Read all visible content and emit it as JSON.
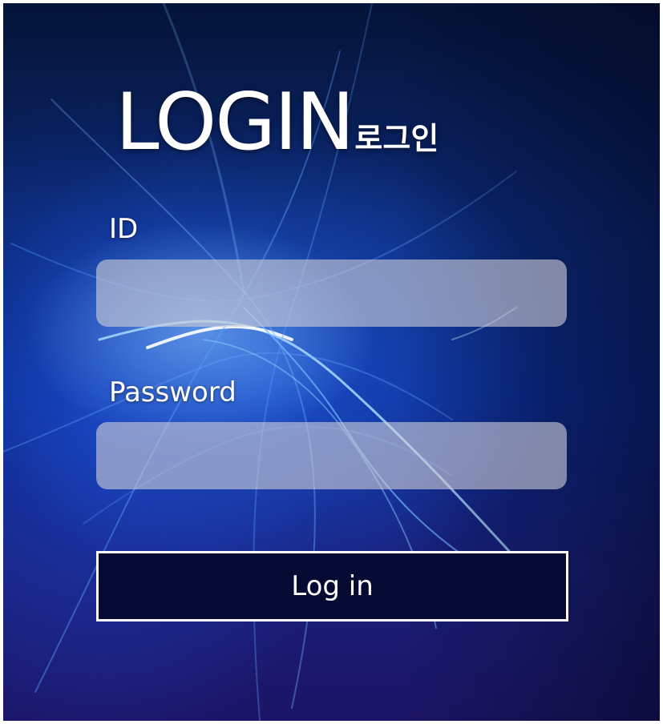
{
  "title": {
    "main": "LOGIN",
    "sub": "로그인"
  },
  "form": {
    "id_label": "ID",
    "id_value": "",
    "password_label": "Password",
    "password_value": "",
    "submit_label": "Log in"
  },
  "colors": {
    "background_dark": "#0b2a7a",
    "input_fill": "#c8c8d2",
    "button_fill": "#050a33",
    "text": "#ffffff"
  }
}
